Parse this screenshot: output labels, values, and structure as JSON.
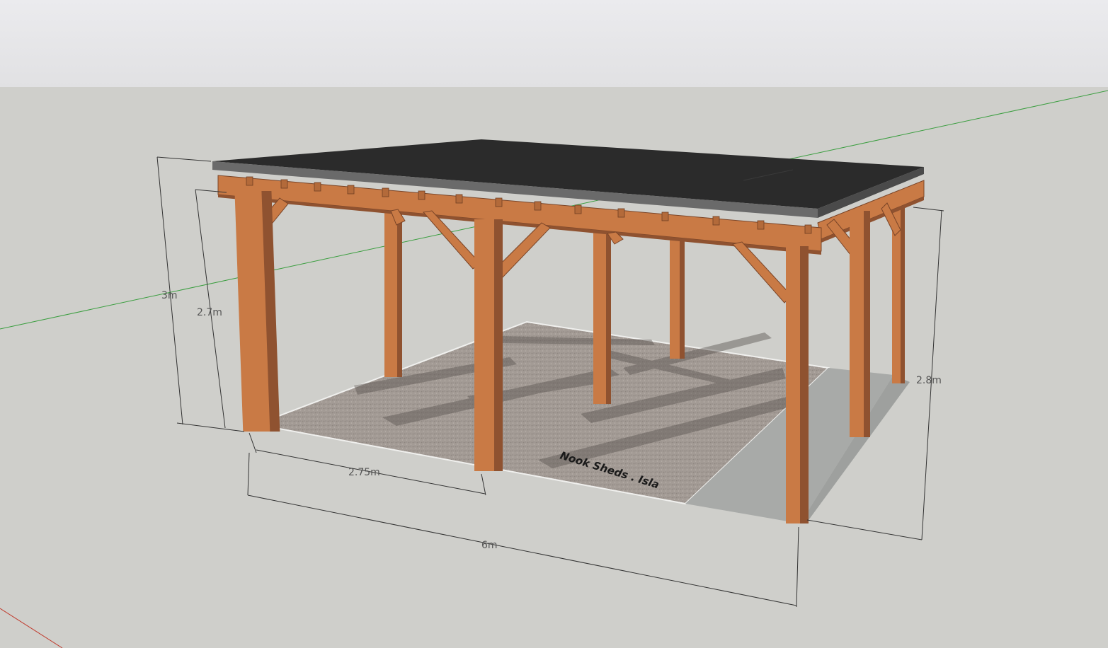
{
  "dimensions": {
    "height_outer": "3m",
    "height_eave": "2.7m",
    "height_rear": "2.8m",
    "bay_width": "2.75m",
    "total_length": "6m"
  },
  "watermark": "Nook Sheds . Isla",
  "colors": {
    "sky_top": "#eeeef0",
    "sky_bottom": "#dcdcdc",
    "ground": "#cfcfcb",
    "roof": "#2b2b2b",
    "roof_edge": "#555555",
    "timber_front": "#c97a45",
    "timber_side": "#8f5230",
    "gravel": "#a09993",
    "concrete": "#a8aaa8",
    "green_axis": "#2e9c3a",
    "red_axis": "#c0392b",
    "dimension_line": "#333333"
  }
}
